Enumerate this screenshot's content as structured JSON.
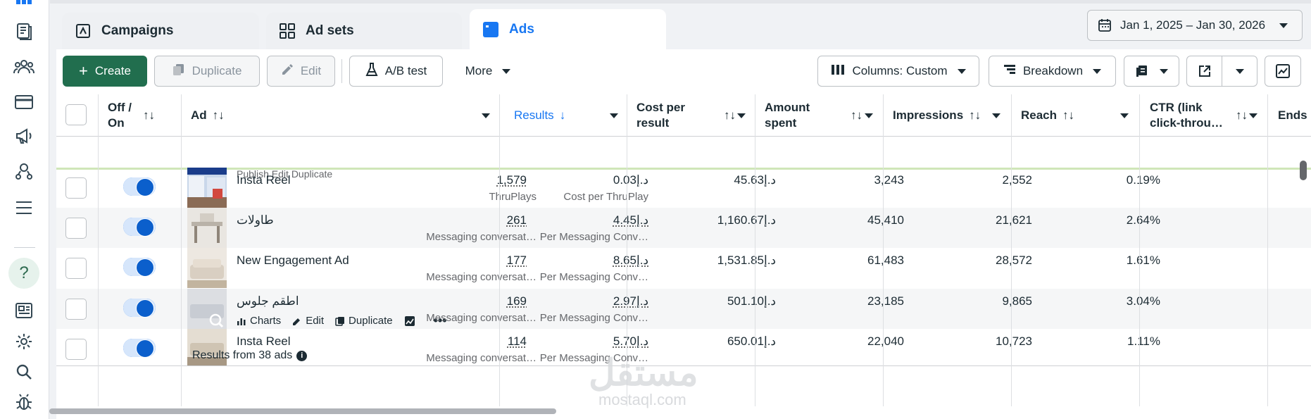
{
  "tabs": [
    {
      "label": "Campaigns",
      "icon": "campaign-icon"
    },
    {
      "label": "Ad sets",
      "icon": "adsets-icon"
    },
    {
      "label": "Ads",
      "icon": "ads-icon"
    }
  ],
  "date_range": "Jan 1, 2025 – Jan 30, 2026",
  "toolbar": {
    "create": "Create",
    "duplicate": "Duplicate",
    "edit": "Edit",
    "ab_test": "A/B test",
    "more": "More",
    "columns": "Columns: Custom",
    "breakdown": "Breakdown"
  },
  "headers": {
    "off_on_1": "Off /",
    "off_on_2": "On",
    "ad": "Ad",
    "results": "Results",
    "cost_1": "Cost per",
    "cost_2": "result",
    "amount_1": "Amount",
    "amount_2": "spent",
    "impressions": "Impressions",
    "reach": "Reach",
    "ctr_1": "CTR (link",
    "ctr_2": "click-throu…",
    "ends": "Ends"
  },
  "rows": [
    {
      "name": "Insta Reel",
      "results": "1,579",
      "results_sub": "ThruPlays",
      "cost": "0.03د.إ",
      "cost_sub": "Cost per ThruPlay",
      "amount": "45.63د.إ",
      "impressions": "3,243",
      "reach": "2,552",
      "ctr": "0.19%"
    },
    {
      "name": "طاولات",
      "results": "261",
      "results_sub": "Messaging conversat…",
      "cost": "4.45د.إ",
      "cost_sub": "Per Messaging Conv…",
      "amount": "1,160.67د.إ",
      "impressions": "45,410",
      "reach": "21,621",
      "ctr": "2.64%"
    },
    {
      "name": "New Engagement Ad",
      "results": "177",
      "results_sub": "Messaging conversat…",
      "cost": "8.65د.إ",
      "cost_sub": "Per Messaging Conv…",
      "amount": "1,531.85د.إ",
      "impressions": "61,483",
      "reach": "28,572",
      "ctr": "1.61%"
    },
    {
      "name": "اطقم جلوس",
      "results": "169",
      "results_sub": "Messaging conversat…",
      "cost": "2.97د.إ",
      "cost_sub": "Per Messaging Conv…",
      "amount": "501.10د.إ",
      "impressions": "23,185",
      "reach": "9,865",
      "ctr": "3.04%"
    },
    {
      "name": "Insta Reel",
      "results": "114",
      "results_sub": "Messaging conversat…",
      "cost": "5.70د.إ",
      "cost_sub": "Per Messaging Conv…",
      "amount": "650.01د.إ",
      "impressions": "22,040",
      "reach": "10,723",
      "ctr": "1.11%"
    }
  ],
  "row_actions": {
    "charts": "Charts",
    "edit": "Edit",
    "duplicate": "Duplicate"
  },
  "partial_row_actions": "Publish   Edit   Duplicate",
  "footer": "Results from 38 ads",
  "watermark": {
    "arabic": "مستقل",
    "latin": "mostaql.com"
  }
}
